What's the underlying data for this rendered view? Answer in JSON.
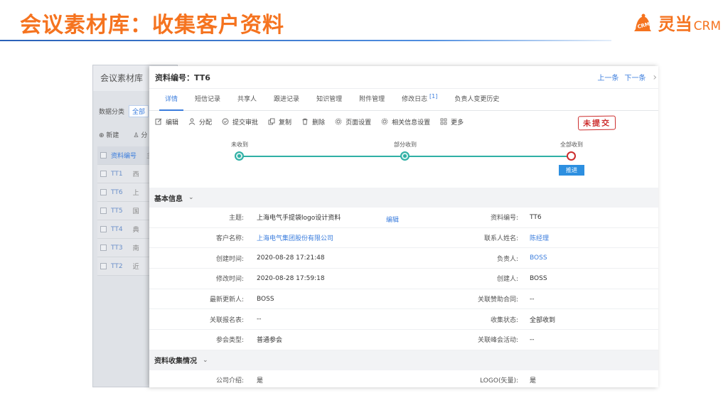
{
  "slide": {
    "title": "会议素材库：收集客户资料",
    "brand": {
      "name": "灵当",
      "suffix": "CRM",
      "mark_text": "CRM",
      "color": "#f5731f"
    }
  },
  "background_window": {
    "title": "会议素材库",
    "filter_label": "数据分类",
    "filter_chip": "全部",
    "actions": [
      "新建",
      "分"
    ],
    "table_header": "资料编号",
    "header_extra": "主",
    "rows": [
      {
        "id": "TT1",
        "extra": "西"
      },
      {
        "id": "TT6",
        "extra": "上"
      },
      {
        "id": "TT5",
        "extra": "国"
      },
      {
        "id": "TT4",
        "extra": "典"
      },
      {
        "id": "TT3",
        "extra": "南"
      },
      {
        "id": "TT2",
        "extra": "近"
      }
    ]
  },
  "panel": {
    "record_title": "资料编号：TT6",
    "nav": {
      "prev": "上一条",
      "next": "下一条"
    },
    "tabs": [
      {
        "label": "详情",
        "active": true
      },
      {
        "label": "短信记录"
      },
      {
        "label": "共享人"
      },
      {
        "label": "跟进记录"
      },
      {
        "label": "知识管理"
      },
      {
        "label": "附件管理"
      },
      {
        "label": "修改日志",
        "badge": "[1]"
      },
      {
        "label": "负责人变更历史"
      }
    ],
    "toolbar": [
      {
        "label": "编辑",
        "icon": "edit-icon"
      },
      {
        "label": "分配",
        "icon": "user-icon"
      },
      {
        "label": "提交审批",
        "icon": "check-circle-icon"
      },
      {
        "label": "复制",
        "icon": "copy-icon"
      },
      {
        "label": "删除",
        "icon": "trash-icon"
      },
      {
        "label": "页面设置",
        "icon": "gear-icon"
      },
      {
        "label": "相关信息设置",
        "icon": "gear-icon"
      },
      {
        "label": "更多",
        "icon": "grid-icon"
      }
    ],
    "stamp": "未提交",
    "progress": {
      "stages": [
        "未收到",
        "部分收到",
        "全部收到"
      ],
      "current_stage": "全部收到",
      "advance_label": "推进",
      "done_color": "#2fb0a5",
      "current_color": "#cc2d2d"
    },
    "basic_section": "基本信息",
    "edit_link": "编辑",
    "basic_rows": [
      {
        "l1": "主题:",
        "v1": "上海电气手提袋logo设计资料",
        "l2": "资料编号:",
        "v2": "TT6"
      },
      {
        "l1": "客户名称:",
        "v1": "上海电气集团股份有限公司",
        "v1_link": true,
        "l2": "联系人姓名:",
        "v2": "陈经理",
        "v2_link": true
      },
      {
        "l1": "创建时间:",
        "v1": "2020-08-28 17:21:48",
        "l2": "负责人:",
        "v2": "BOSS",
        "v2_link": true
      },
      {
        "l1": "修改时间:",
        "v1": "2020-08-28 17:59:18",
        "l2": "创建人:",
        "v2": "BOSS"
      },
      {
        "l1": "最新更新人:",
        "v1": "BOSS",
        "l2": "关联赞助合同:",
        "v2": "--"
      },
      {
        "l1": "关联报名表:",
        "v1": "--",
        "l2": "收集状态:",
        "v2": "全部收到"
      },
      {
        "l1": "参会类型:",
        "v1": "普通参会",
        "l2": "关联峰会活动:",
        "v2": "--"
      }
    ],
    "collect_section": "资料收集情况",
    "collect_rows": [
      {
        "l1": "公司介绍:",
        "v1": "是",
        "l2": "LOGO(矢量):",
        "v2": "是"
      }
    ],
    "accent": "#3b7ddd"
  }
}
